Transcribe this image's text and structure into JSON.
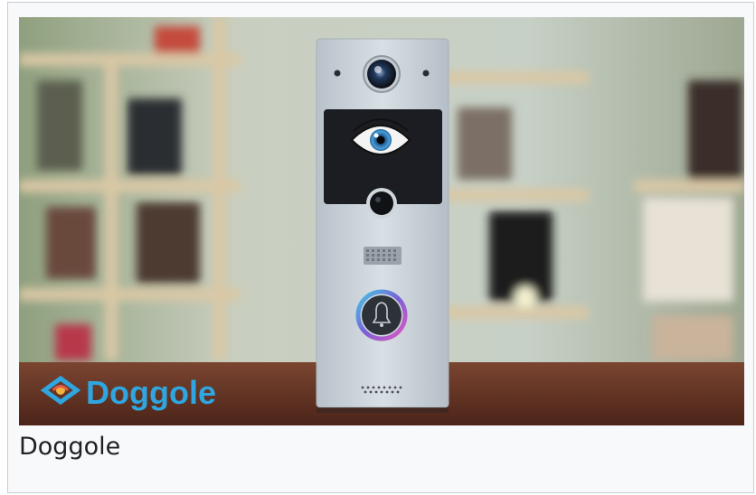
{
  "figure": {
    "caption": "Doggole",
    "logo_text": "Doggole",
    "logo_icon": "shield-eye-logo",
    "device_icons": {
      "camera": "camera-lens-icon",
      "eye": "eye-icon",
      "sensor": "sensor-icon",
      "bell": "bell-icon"
    },
    "colors": {
      "logo_text": "#2fa6e0",
      "bell_ring": "#7b5fd6",
      "plate": "#cfd6dc",
      "eye_panel": "#1b1d22",
      "table": "#6b3a28"
    }
  }
}
